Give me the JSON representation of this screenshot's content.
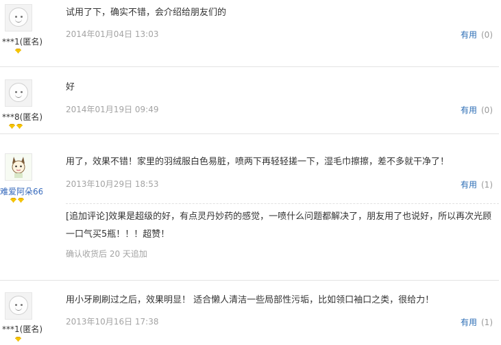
{
  "reviews": [
    {
      "text": "试用了下，确实不错，会介绍给朋友们的",
      "date": "2014年01月04日 13:03",
      "username": "***1(匿名)",
      "useful_label": "有用",
      "useful_count": "(0)"
    },
    {
      "text": "好",
      "date": "2014年01月19日 09:49",
      "username": "***8(匿名)",
      "useful_label": "有用",
      "useful_count": "(0)"
    },
    {
      "text": "用了，效果不错！家里的羽绒服白色易脏，喷两下再轻轻搓一下，湿毛巾擦擦，差不多就干净了！",
      "date": "2013年10月29日 18:53",
      "username": "难爱阿朵66",
      "useful_label": "有用",
      "useful_count": "(1)",
      "append": {
        "text": "[追加评论]效果是超级的好，有点灵丹妙药的感觉，一喷什么问题都解决了，朋友用了也说好，所以再次光顾一口气买5瓶！！！超赞！",
        "note": "确认收货后 20 天追加"
      }
    },
    {
      "text": "用小牙刷刷过之后，效果明显！ 适合懒人清洁一些局部性污垢，比如领口袖口之类，很给力！",
      "date": "2013年10月16日 17:38",
      "username": "***1(匿名)",
      "useful_label": "有用",
      "useful_count": "(1)"
    }
  ]
}
